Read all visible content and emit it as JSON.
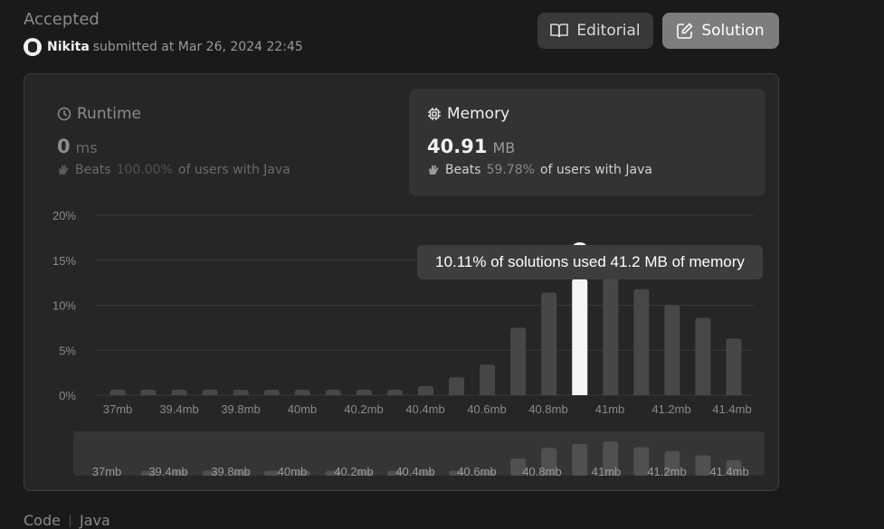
{
  "header": {
    "status": "Accepted",
    "user_name": "Nikita",
    "submitted_text": "submitted at Mar 26, 2024 22:45",
    "editorial_label": "Editorial",
    "solution_label": "Solution"
  },
  "runtime": {
    "title": "Runtime",
    "value": "0",
    "unit": "ms",
    "beats_label": "Beats",
    "beats_pct": "100.00%",
    "beats_suffix": "of users with Java"
  },
  "memory": {
    "title": "Memory",
    "value": "40.91",
    "unit": "MB",
    "beats_label": "Beats",
    "beats_pct": "59.78%",
    "beats_suffix": "of users with Java"
  },
  "tooltip": "10.11% of solutions used 41.2 MB of memory",
  "colors": {
    "bar": "#474747",
    "bar_highlight": "#f5f5f5",
    "grid": "#3a3a3a"
  },
  "chart_data": {
    "type": "bar",
    "ylim": [
      0,
      20
    ],
    "y_ticks": [
      "20%",
      "15%",
      "10%",
      "5%",
      "0%"
    ],
    "y_tick_values": [
      20,
      15,
      10,
      5,
      0
    ],
    "x_tick_labels": [
      "37mb",
      "39.4mb",
      "39.8mb",
      "40mb",
      "40.2mb",
      "40.4mb",
      "40.6mb",
      "40.8mb",
      "41mb",
      "41.2mb",
      "41.4mb"
    ],
    "values": [
      0.6,
      0.6,
      0.6,
      0.6,
      0.6,
      0.6,
      0.6,
      0.6,
      0.6,
      0.6,
      1.0,
      2.0,
      3.4,
      7.5,
      11.4,
      12.9,
      13.8,
      11.8,
      10.0,
      8.6,
      6.3
    ],
    "highlight_index": 15,
    "overview_values": [
      0,
      0.6,
      0.6,
      0.6,
      0.6,
      0.6,
      0.6,
      0.6,
      0.6,
      0.6,
      0.6,
      0.6,
      0.6,
      2.1,
      3.4,
      3.9,
      4.2,
      3.5,
      3.0,
      2.5,
      1.9
    ]
  },
  "footer": {
    "code_label": "Code",
    "language": "Java"
  }
}
